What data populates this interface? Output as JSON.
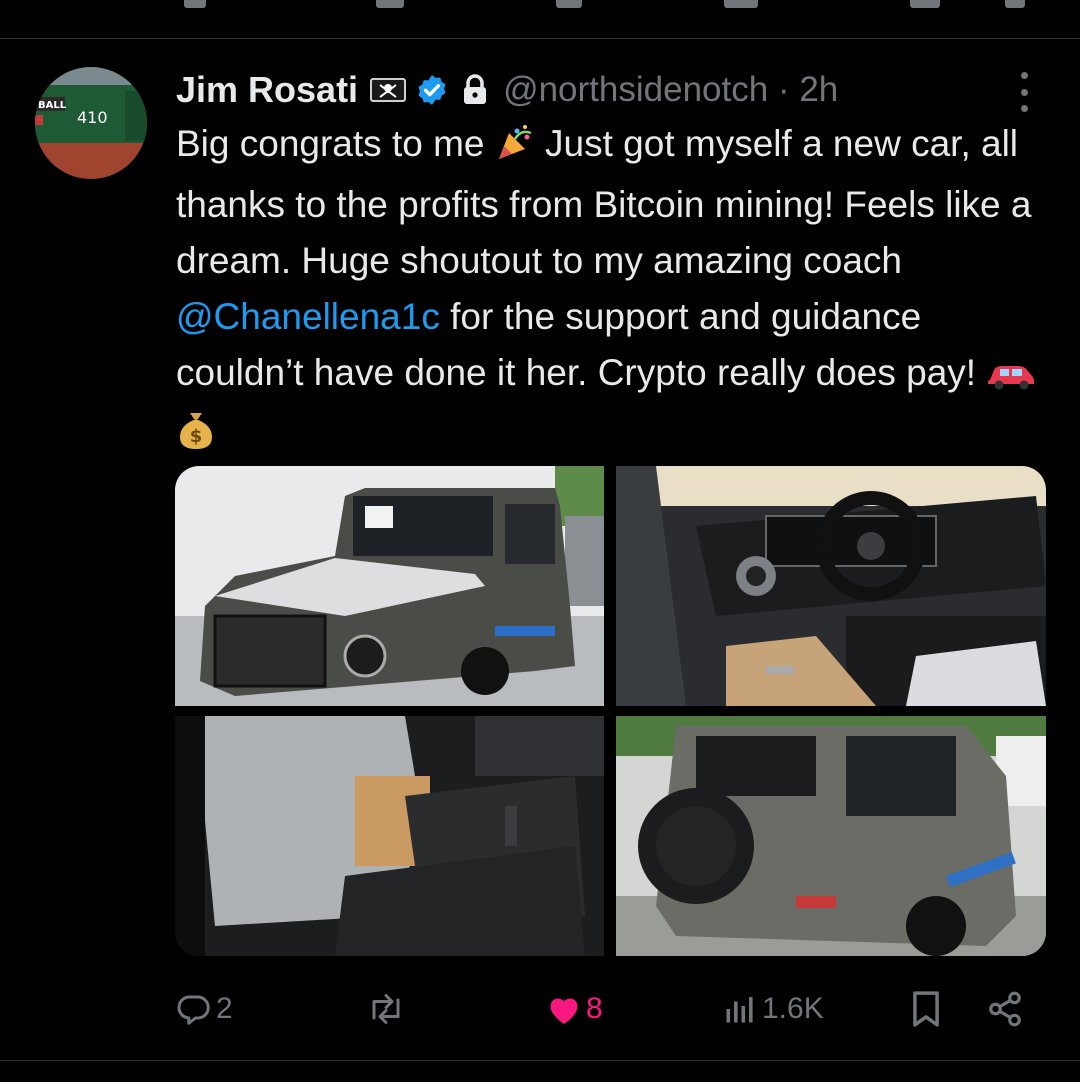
{
  "tweet": {
    "author_name": "Jim Rosati",
    "handle": "@northsidenotch",
    "separator": "·",
    "time": "2h",
    "text_segments": [
      {
        "t": "text",
        "v": "Big congrats to me "
      },
      {
        "t": "emoji",
        "v": "party-popper"
      },
      {
        "t": "text",
        "v": " Just got myself a new car, all thanks to the profits from Bitcoin mining! Feels like a dream. Huge shoutout to my amazing coach "
      },
      {
        "t": "mention",
        "v": "@Chanellena1c"
      },
      {
        "t": "text",
        "v": " for the support and guidance couldn’t have done it her. Crypto really does pay! "
      },
      {
        "t": "emoji",
        "v": "red-car"
      },
      {
        "t": "emoji",
        "v": "money-bag"
      }
    ],
    "avatar_sign": {
      "ball": "BALL",
      "distance": "410"
    }
  },
  "actions": {
    "replies": "2",
    "reposts": "",
    "likes": "8",
    "views": "1.6K"
  },
  "icons": [
    "pirate-flag-icon",
    "verified-badge-icon",
    "lock-icon",
    "more-icon",
    "reply-icon",
    "repost-icon",
    "heart-icon",
    "views-icon",
    "bookmark-icon",
    "share-icon"
  ],
  "colors": {
    "background": "#000000",
    "text": "#e7e9ea",
    "muted": "#71767b",
    "mention": "#1d9bf0",
    "like": "#f91880",
    "divider": "#2f3336"
  }
}
